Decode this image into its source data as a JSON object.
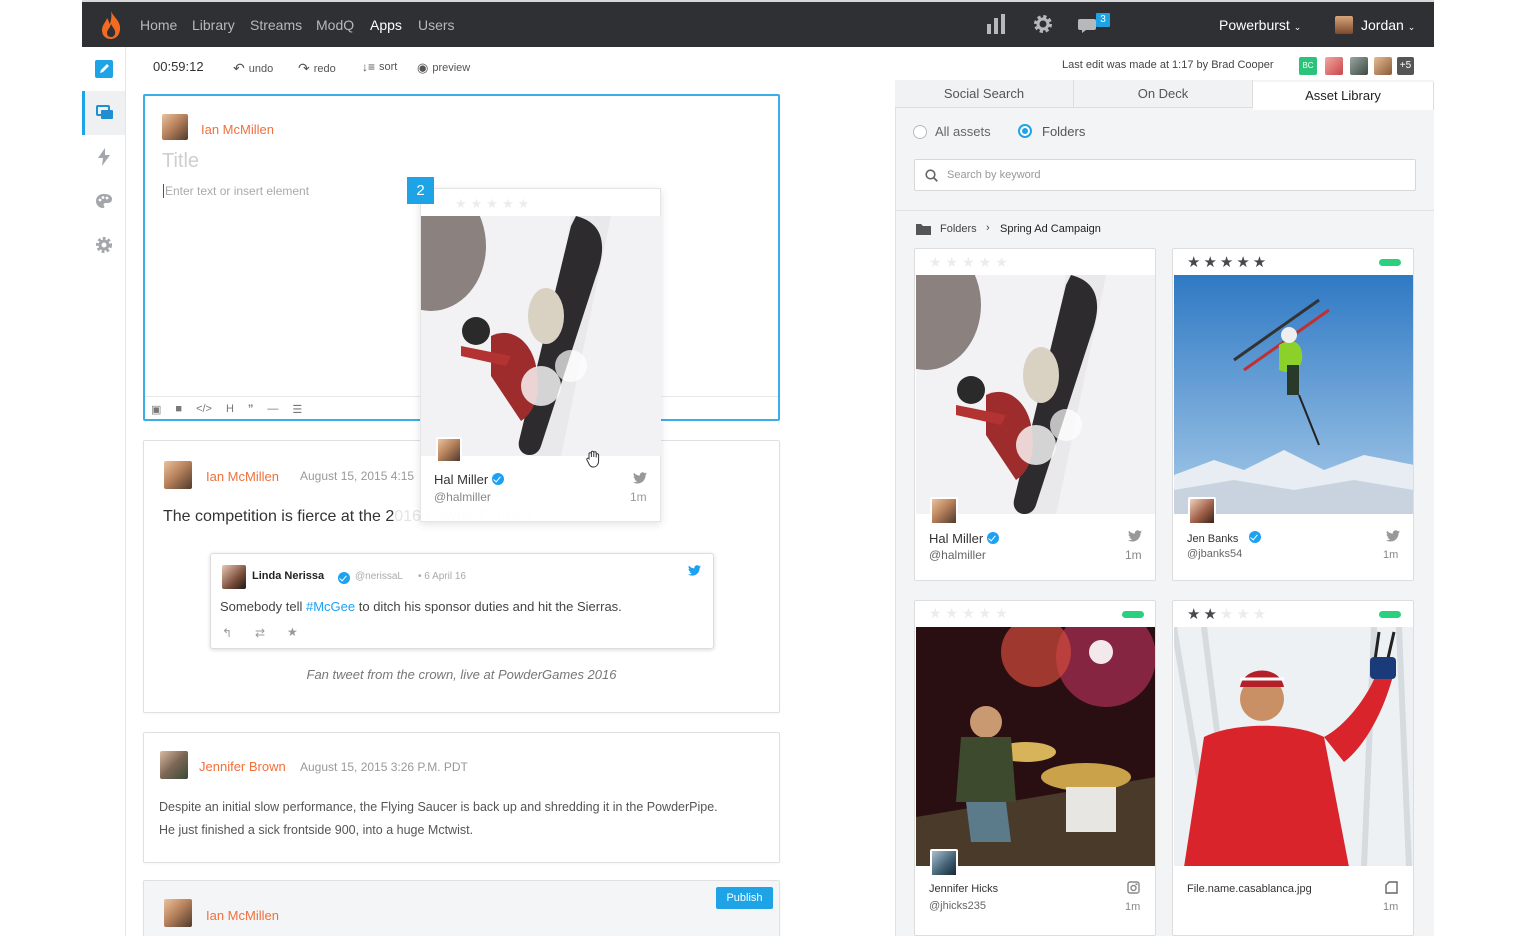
{
  "nav": {
    "items": [
      "Home",
      "Library",
      "Streams",
      "ModQ",
      "Apps",
      "Users"
    ],
    "notification_count": "3",
    "org": "Powerburst",
    "user": "Jordan"
  },
  "toolbar": {
    "timer": "00:59:12",
    "undo": "undo",
    "redo": "redo",
    "sort": "sort",
    "preview": "preview",
    "last_edit": "Last edit was made at 1:17 by Brad Cooper",
    "collab_initials": "BC",
    "collab_more": "+5"
  },
  "editor": {
    "author": "Ian McMillen",
    "title_placeholder": "Title",
    "body_placeholder": "Enter text or insert element",
    "drop_index": "2",
    "drag_card": {
      "name": "Hal Miller",
      "handle": "@halmiller",
      "time": "1m"
    }
  },
  "posts": [
    {
      "author": "Ian McMillen",
      "time": "August 15, 2015 4:15",
      "text": "The competition is fierce at the 2",
      "text_faded": "016 PowderGames",
      "tweet": {
        "name": "Linda Nerissa",
        "handle": "@nerissaL",
        "date": "• 6 April 16",
        "pre": "Somebody tell ",
        "hashtag": "#McGee",
        "post": " to ditch his sponsor duties and hit the Sierras."
      },
      "caption": "Fan tweet from the crown, live at PowderGames 2016"
    },
    {
      "author": "Jennifer Brown",
      "time": "August 15, 2015 3:26 P.M. PDT",
      "line1": "Despite an initial slow performance, the Flying Saucer is back up and shredding it in the PowderPipe.",
      "line2": "He just finished a sick frontside 900, into a huge Mctwist."
    },
    {
      "author": "Ian McMillen",
      "publish": "Publish"
    }
  ],
  "right_panel": {
    "tabs": [
      "Social Search",
      "On Deck",
      "Asset Library"
    ],
    "filter_all": "All assets",
    "filter_folders": "Folders",
    "search_placeholder": "Search by keyword",
    "breadcrumb_root": "Folders",
    "breadcrumb_current": "Spring Ad Campaign",
    "assets": [
      {
        "name": "Hal Miller",
        "handle": "@halmiller",
        "time": "1m",
        "rating": 0,
        "source": "twitter-icon"
      },
      {
        "name": "Jen Banks",
        "handle": "@jbanks54",
        "time": "1m",
        "rating": 5,
        "source": "twitter-icon"
      },
      {
        "name": "Jennifer Hicks",
        "handle": "@jhicks235",
        "time": "1m",
        "rating": 0,
        "source": "instagram-icon"
      },
      {
        "name": "File.name.casablanca.jpg",
        "time": "1m",
        "rating": 2,
        "source": "file-icon"
      }
    ]
  },
  "colors": {
    "accent": "#1ea3e6",
    "author": "#f0703c",
    "nav_bg": "#2f3033",
    "approved": "#2bd07e"
  }
}
